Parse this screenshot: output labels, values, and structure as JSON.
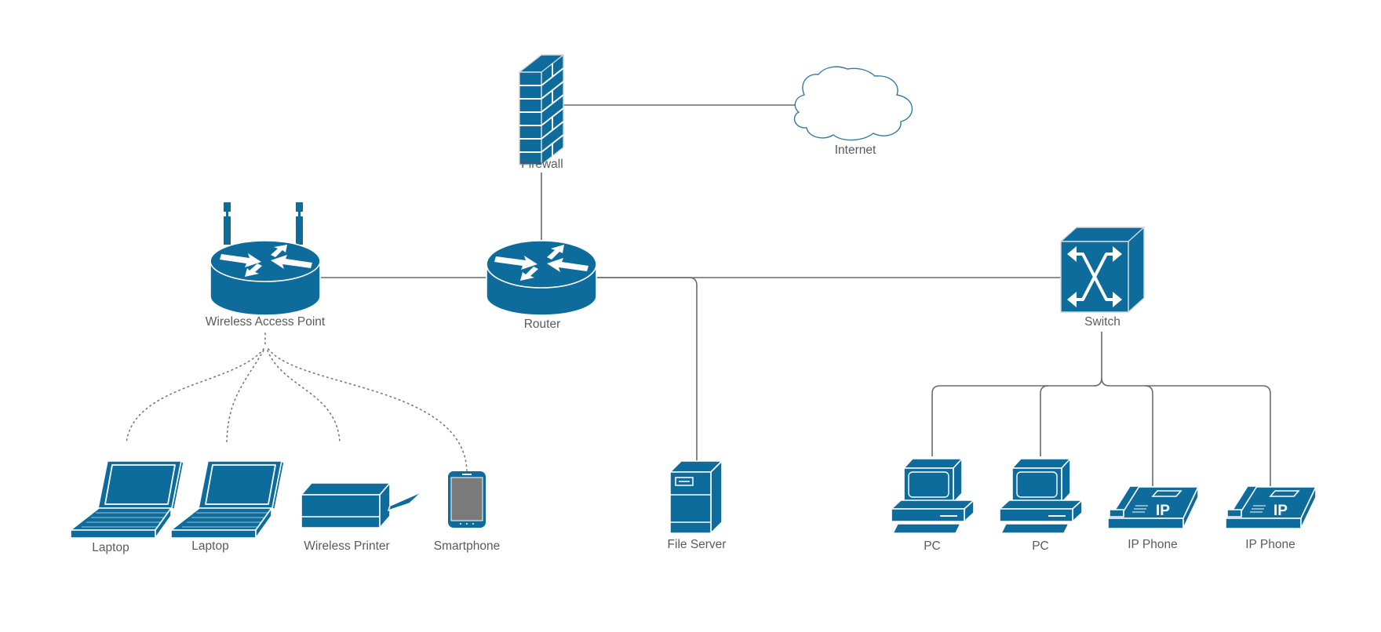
{
  "diagram": {
    "type": "network-topology",
    "accent_color": "#0e6c9c",
    "line_color": "#6b6b6b",
    "nodes": {
      "firewall": {
        "label": "Firewall",
        "icon": "firewall-icon"
      },
      "internet": {
        "label": "Internet",
        "icon": "cloud-icon"
      },
      "wap": {
        "label": "Wireless Access Point",
        "icon": "wireless-router-icon"
      },
      "router": {
        "label": "Router",
        "icon": "router-icon"
      },
      "switch": {
        "label": "Switch",
        "icon": "switch-icon"
      },
      "file_server": {
        "label": "File Server",
        "icon": "server-icon"
      },
      "laptop1": {
        "label": "Laptop",
        "icon": "laptop-icon"
      },
      "laptop2": {
        "label": "Laptop",
        "icon": "laptop-icon"
      },
      "printer": {
        "label": "Wireless Printer",
        "icon": "printer-icon"
      },
      "smartphone": {
        "label": "Smartphone",
        "icon": "smartphone-icon"
      },
      "pc1": {
        "label": "PC",
        "icon": "pc-icon"
      },
      "pc2": {
        "label": "PC",
        "icon": "pc-icon"
      },
      "ipphone1": {
        "label": "IP Phone",
        "icon": "ip-phone-icon",
        "badge": "IP"
      },
      "ipphone2": {
        "label": "IP Phone",
        "icon": "ip-phone-icon",
        "badge": "IP"
      }
    },
    "links": [
      {
        "from": "firewall",
        "to": "internet",
        "style": "solid"
      },
      {
        "from": "firewall",
        "to": "router",
        "style": "solid"
      },
      {
        "from": "wap",
        "to": "router",
        "style": "solid"
      },
      {
        "from": "router",
        "to": "switch",
        "style": "solid"
      },
      {
        "from": "router",
        "to": "file_server",
        "style": "solid"
      },
      {
        "from": "switch",
        "to": "pc1",
        "style": "solid"
      },
      {
        "from": "switch",
        "to": "pc2",
        "style": "solid"
      },
      {
        "from": "switch",
        "to": "ipphone1",
        "style": "solid"
      },
      {
        "from": "switch",
        "to": "ipphone2",
        "style": "solid"
      },
      {
        "from": "wap",
        "to": "laptop1",
        "style": "dotted"
      },
      {
        "from": "wap",
        "to": "laptop2",
        "style": "dotted"
      },
      {
        "from": "wap",
        "to": "printer",
        "style": "dotted"
      },
      {
        "from": "wap",
        "to": "smartphone",
        "style": "dotted"
      }
    ]
  }
}
